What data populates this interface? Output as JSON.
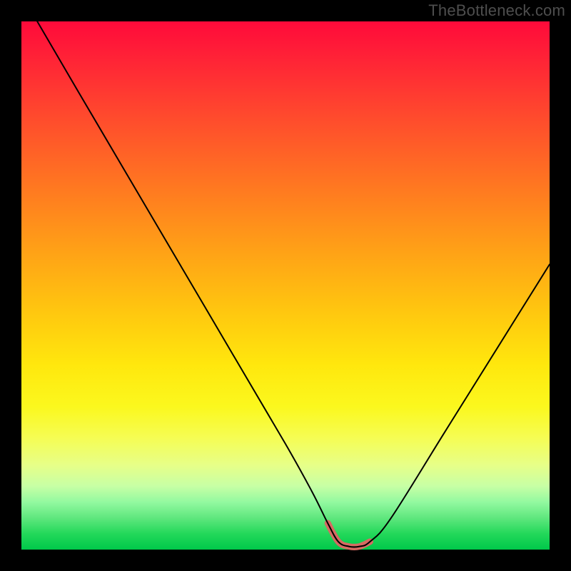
{
  "watermark": "TheBottleneck.com",
  "chart_data": {
    "type": "line",
    "title": "",
    "xlabel": "",
    "ylabel": "",
    "xlim": [
      0,
      100
    ],
    "ylim": [
      0,
      100
    ],
    "grid": false,
    "legend": false,
    "series": [
      {
        "name": "main-curve",
        "color": "#000000",
        "x": [
          3,
          10,
          20,
          30,
          40,
          50,
          55,
          58,
          60,
          62,
          64,
          66,
          70,
          80,
          90,
          100
        ],
        "values": [
          100,
          88,
          71,
          54,
          37,
          20,
          11,
          5,
          1.5,
          0.6,
          0.6,
          1.5,
          6,
          22,
          38,
          54
        ]
      },
      {
        "name": "bottom-highlight",
        "color": "#d66a62",
        "x": [
          58,
          60,
          62,
          64,
          66
        ],
        "values": [
          5,
          1.5,
          0.6,
          0.6,
          1.5
        ]
      }
    ],
    "annotations": []
  }
}
